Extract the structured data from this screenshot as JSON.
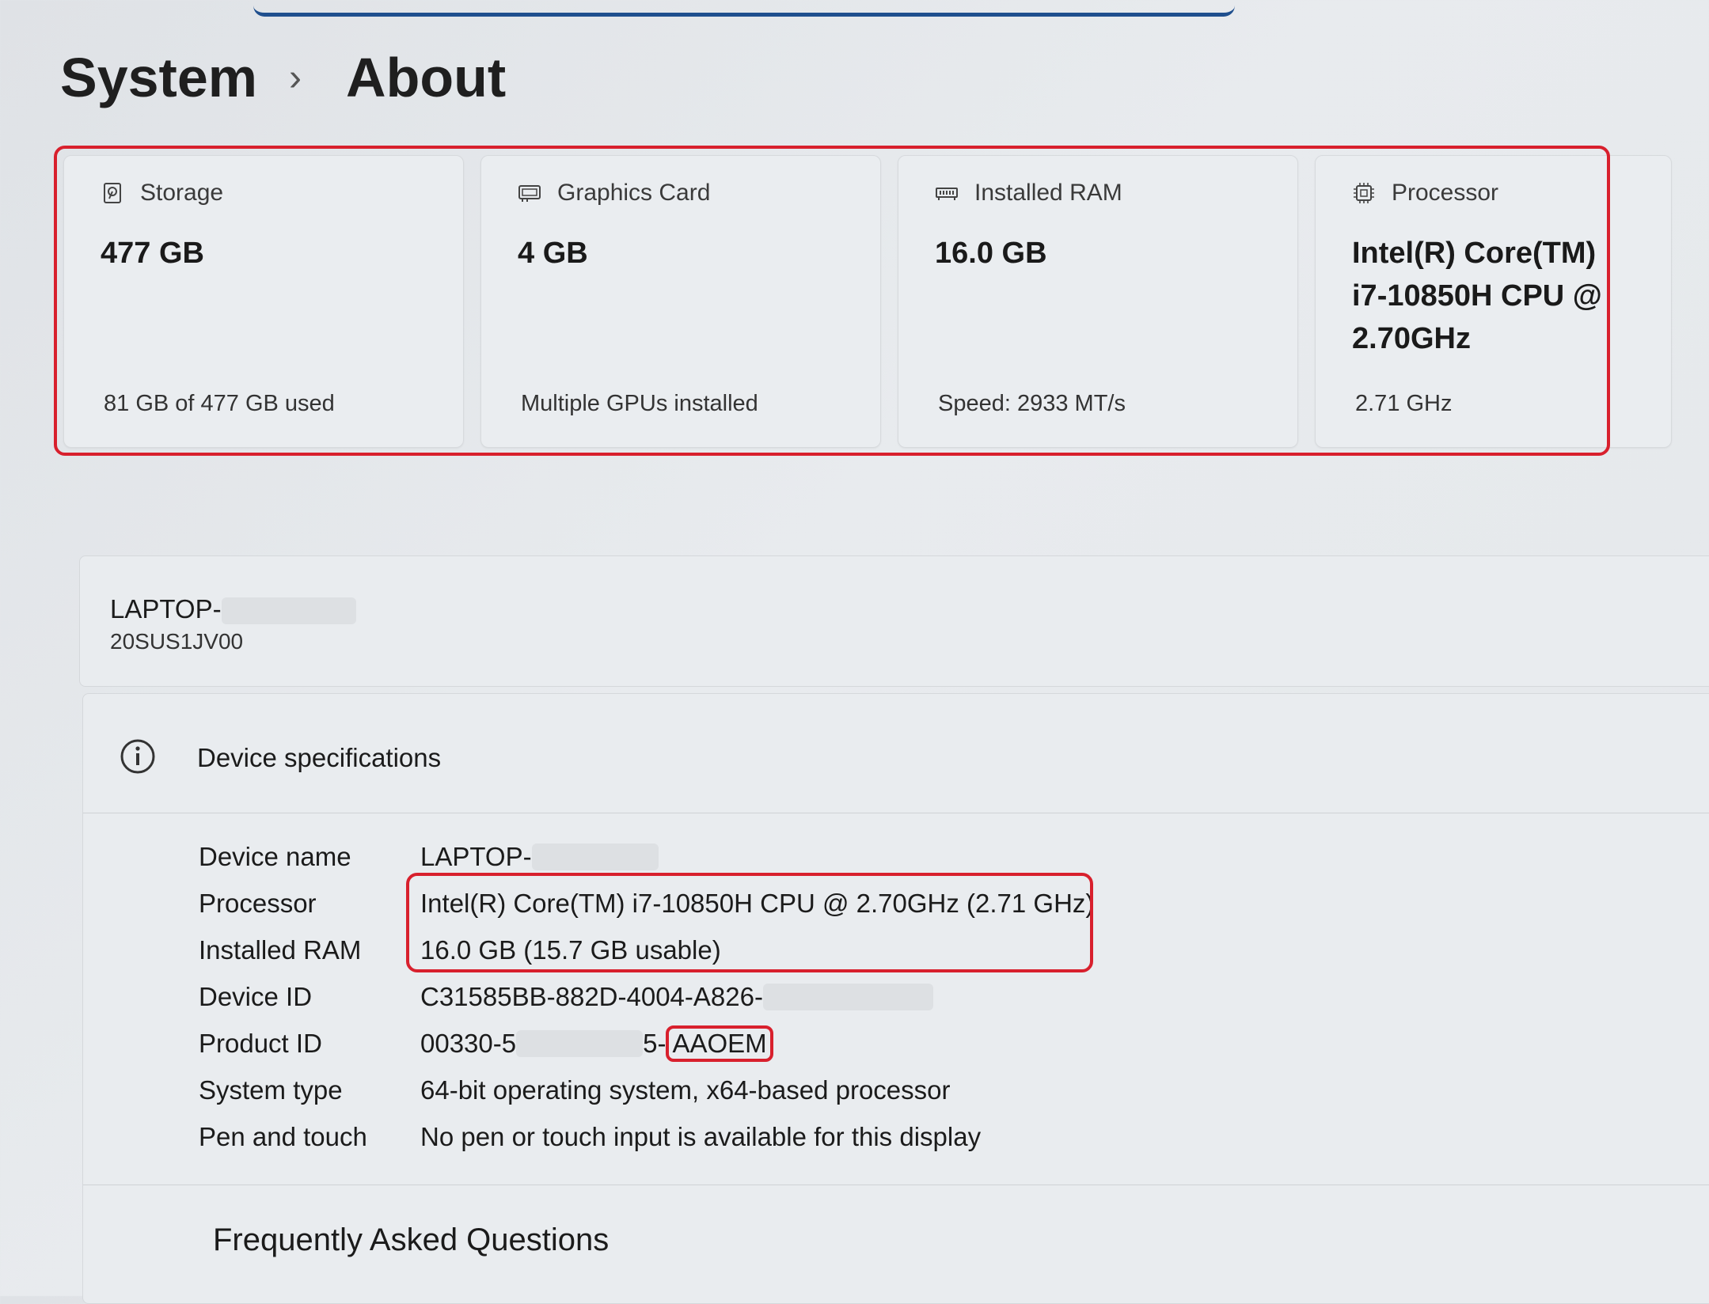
{
  "breadcrumb": {
    "parent": "System",
    "separator": "›",
    "current": "About"
  },
  "cards": [
    {
      "label": "Storage",
      "icon": "storage-icon",
      "value": "477 GB",
      "sub": "81 GB of 477 GB used"
    },
    {
      "label": "Graphics Card",
      "icon": "graphics-card-icon",
      "value": "4 GB",
      "sub": "Multiple GPUs installed"
    },
    {
      "label": "Installed RAM",
      "icon": "ram-icon",
      "value": "16.0 GB",
      "sub": "Speed: 2933 MT/s"
    },
    {
      "label": "Processor",
      "icon": "processor-icon",
      "value": "Intel(R) Core(TM) i7-10850H CPU @ 2.70GHz",
      "sub": "2.71 GHz"
    }
  ],
  "device": {
    "name": "LAPTOP-",
    "model": "20SUS1JV00"
  },
  "specs": {
    "title": "Device specifications",
    "rows": [
      {
        "key": "Device name",
        "value": "LAPTOP-"
      },
      {
        "key": "Processor",
        "value": "Intel(R) Core(TM) i7-10850H CPU @ 2.70GHz (2.71 GHz)"
      },
      {
        "key": "Installed RAM",
        "value": "16.0 GB (15.7 GB usable)"
      },
      {
        "key": "Device ID",
        "value": "C31585BB-882D-4004-A826-"
      },
      {
        "key": "Product ID",
        "value": "00330-5",
        "value_tail": "5-",
        "value_suffix": "AAOEM"
      },
      {
        "key": "System type",
        "value": "64-bit operating system, x64-based processor"
      },
      {
        "key": "Pen and touch",
        "value": "No pen or touch input is available for this display"
      }
    ]
  },
  "faq": {
    "title": "Frequently Asked Questions"
  },
  "colors": {
    "highlight": "#d8202d",
    "accent_bar": "#1f4f8e",
    "background": "#e4e7ea"
  }
}
